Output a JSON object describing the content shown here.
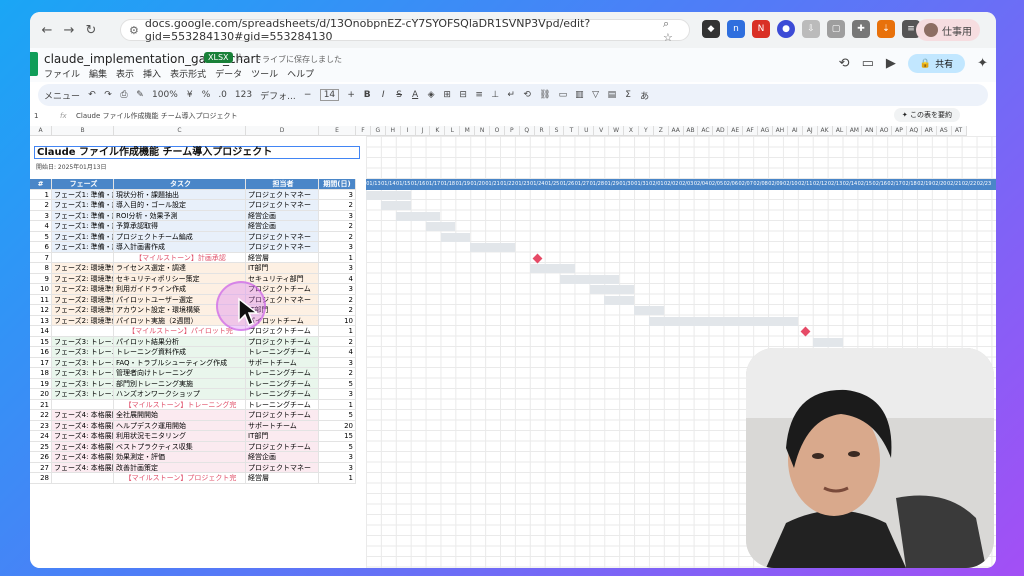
{
  "browser": {
    "url": "docs.google.com/spreadsheets/d/13OnobpnEZ-cY7SYOFSQlaDR1SVNP3Vpd/edit?gid=553284130#gid=553284130",
    "profile": "仕事用"
  },
  "doc": {
    "title": "claude_implementation_gantt_chart",
    "badge": "XLSX",
    "saved": "ドライブに保存しました",
    "menus": [
      "ファイル",
      "編集",
      "表示",
      "挿入",
      "表示形式",
      "データ",
      "ツール",
      "ヘルプ"
    ],
    "share": "共有"
  },
  "toolbar": {
    "menu": "メニュー",
    "zoom": "100%",
    "currency": "¥",
    "percent": "%",
    "fmt": "123",
    "font": "デフォ...",
    "size": "14",
    "bold": "B",
    "ime": "あ"
  },
  "formula": {
    "ref": "1",
    "content": "Claude ファイル作成機能 チーム導入プロジェクト",
    "explain": "この表を要約"
  },
  "columns": [
    "A",
    "B",
    "C",
    "D",
    "E",
    "F",
    "G",
    "H",
    "I",
    "J",
    "K",
    "L",
    "M",
    "N",
    "O",
    "P",
    "Q",
    "R",
    "S",
    "T",
    "U",
    "V",
    "W",
    "X",
    "Y",
    "Z",
    "AA",
    "AB",
    "AC",
    "AD",
    "AE",
    "AF",
    "AG",
    "AH",
    "AI",
    "AJ",
    "AK",
    "AL",
    "AM",
    "AN",
    "AO",
    "AP",
    "AQ",
    "AR",
    "AS",
    "AT"
  ],
  "project": {
    "title": "Claude ファイル作成機能 チーム導入プロジェクト",
    "start": "開始日: 2025年01月13日"
  },
  "headers": {
    "no": "#",
    "phase": "フェーズ",
    "task": "タスク",
    "owner": "担当者",
    "days": "期間(日)"
  },
  "dates": [
    "01/13",
    "01/14",
    "01/15",
    "01/16",
    "01/17",
    "01/18",
    "01/19",
    "01/20",
    "01/21",
    "01/22",
    "01/23",
    "01/24",
    "01/25",
    "01/26",
    "01/27",
    "01/28",
    "01/29",
    "01/30",
    "01/31",
    "02/01",
    "02/02",
    "02/03",
    "02/04",
    "02/05",
    "02/06",
    "02/07",
    "02/08",
    "02/09",
    "02/10",
    "02/11",
    "02/12",
    "02/13",
    "02/14",
    "02/15",
    "02/16",
    "02/17",
    "02/18",
    "02/19",
    "02/20",
    "02/21",
    "02/22",
    "02/23"
  ],
  "rows": [
    {
      "n": "1",
      "phase": "フェーズ1: 準備・計",
      "task": "現状分析・課題抽出",
      "owner": "プロジェクトマネー",
      "days": "3",
      "cls": "phase1",
      "start": 0,
      "len": 3
    },
    {
      "n": "2",
      "phase": "フェーズ1: 準備・計",
      "task": "導入目的・ゴール設定",
      "owner": "プロジェクトマネー",
      "days": "2",
      "cls": "phase1",
      "start": 1,
      "len": 2
    },
    {
      "n": "3",
      "phase": "フェーズ1: 準備・計",
      "task": "ROI分析・効果予測",
      "owner": "経営企画",
      "days": "3",
      "cls": "phase1",
      "start": 2,
      "len": 3
    },
    {
      "n": "4",
      "phase": "フェーズ1: 準備・計",
      "task": "予算承認取得",
      "owner": "経営企画",
      "days": "2",
      "cls": "phase1",
      "start": 4,
      "len": 2
    },
    {
      "n": "5",
      "phase": "フェーズ1: 準備・計",
      "task": "プロジェクトチーム編成",
      "owner": "プロジェクトマネー",
      "days": "2",
      "cls": "phase1",
      "start": 5,
      "len": 2
    },
    {
      "n": "6",
      "phase": "フェーズ1: 準備・計",
      "task": "導入計画書作成",
      "owner": "プロジェクトマネー",
      "days": "3",
      "cls": "phase1",
      "start": 7,
      "len": 3
    },
    {
      "n": "7",
      "phase": "",
      "task": "【マイルストーン】計画承認",
      "owner": "経営層",
      "days": "1",
      "cls": "milestone",
      "start": 11,
      "len": 0
    },
    {
      "n": "8",
      "phase": "フェーズ2: 環境準備",
      "task": "ライセンス選定・調達",
      "owner": "IT部門",
      "days": "3",
      "cls": "phase2",
      "start": 11,
      "len": 3
    },
    {
      "n": "9",
      "phase": "フェーズ2: 環境準備",
      "task": "セキュリティポリシー策定",
      "owner": "セキュリティ部門",
      "days": "4",
      "cls": "phase2",
      "start": 13,
      "len": 4
    },
    {
      "n": "10",
      "phase": "フェーズ2: 環境準備",
      "task": "利用ガイドライン作成",
      "owner": "プロジェクトチーム",
      "days": "3",
      "cls": "phase2",
      "start": 15,
      "len": 3
    },
    {
      "n": "11",
      "phase": "フェーズ2: 環境準備",
      "task": "パイロットユーザー選定",
      "owner": "プロジェクトマネー",
      "days": "2",
      "cls": "phase2",
      "start": 16,
      "len": 2
    },
    {
      "n": "12",
      "phase": "フェーズ2: 環境準備",
      "task": "アカウント設定・環境構築",
      "owner": "IT部門",
      "days": "2",
      "cls": "phase2",
      "start": 18,
      "len": 2
    },
    {
      "n": "13",
      "phase": "フェーズ2: 環境準備",
      "task": "パイロット実施（2週間）",
      "owner": "パイロットチーム",
      "days": "10",
      "cls": "phase2",
      "start": 19,
      "len": 10
    },
    {
      "n": "14",
      "phase": "",
      "task": "【マイルストーン】パイロット完",
      "owner": "プロジェクトチーム",
      "days": "1",
      "cls": "milestone",
      "start": 29,
      "len": 0
    },
    {
      "n": "15",
      "phase": "フェーズ3: トレーニ",
      "task": "パイロット結果分析",
      "owner": "プロジェクトチーム",
      "days": "2",
      "cls": "phase3",
      "start": 30,
      "len": 2
    },
    {
      "n": "16",
      "phase": "フェーズ3: トレーニ",
      "task": "トレーニング資料作成",
      "owner": "トレーニングチーム",
      "days": "4",
      "cls": "phase3",
      "start": 31,
      "len": 4
    },
    {
      "n": "17",
      "phase": "フェーズ3: トレーニ",
      "task": "FAQ・トラブルシューティング作成",
      "owner": "サポートチーム",
      "days": "3",
      "cls": "phase3",
      "start": 32,
      "len": 3
    },
    {
      "n": "18",
      "phase": "フェーズ3: トレーニ",
      "task": "管理者向けトレーニング",
      "owner": "トレーニングチーム",
      "days": "2",
      "cls": "phase3",
      "start": 34,
      "len": 2
    },
    {
      "n": "19",
      "phase": "フェーズ3: トレーニ",
      "task": "部門別トレーニング実施",
      "owner": "トレーニングチーム",
      "days": "5",
      "cls": "phase3",
      "start": 35,
      "len": 5
    },
    {
      "n": "20",
      "phase": "フェーズ3: トレーニ",
      "task": "ハンズオンワークショップ",
      "owner": "トレーニングチーム",
      "days": "3",
      "cls": "phase3",
      "start": 37,
      "len": 3
    },
    {
      "n": "21",
      "phase": "",
      "task": "【マイルストーン】トレーニング完",
      "owner": "トレーニングチーム",
      "days": "1",
      "cls": "milestone",
      "start": -1,
      "len": 0
    },
    {
      "n": "22",
      "phase": "フェーズ4: 本格展開",
      "task": "全社展開開始",
      "owner": "プロジェクトチーム",
      "days": "5",
      "cls": "phase4",
      "start": -1,
      "len": 0
    },
    {
      "n": "23",
      "phase": "フェーズ4: 本格展開",
      "task": "ヘルプデスク運用開始",
      "owner": "サポートチーム",
      "days": "20",
      "cls": "phase4",
      "start": -1,
      "len": 0
    },
    {
      "n": "24",
      "phase": "フェーズ4: 本格展開",
      "task": "利用状況モニタリング",
      "owner": "IT部門",
      "days": "15",
      "cls": "phase4",
      "start": -1,
      "len": 0
    },
    {
      "n": "25",
      "phase": "フェーズ4: 本格展開",
      "task": "ベストプラクティス収集",
      "owner": "プロジェクトチーム",
      "days": "5",
      "cls": "phase4",
      "start": -1,
      "len": 0
    },
    {
      "n": "26",
      "phase": "フェーズ4: 本格展開",
      "task": "効果測定・評価",
      "owner": "経営企画",
      "days": "3",
      "cls": "phase4",
      "start": -1,
      "len": 0
    },
    {
      "n": "27",
      "phase": "フェーズ4: 本格展開",
      "task": "改善計画策定",
      "owner": "プロジェクトマネー",
      "days": "3",
      "cls": "phase4",
      "start": -1,
      "len": 0
    },
    {
      "n": "28",
      "phase": "",
      "task": "【マイルストーン】プロジェクト完",
      "owner": "経営層",
      "days": "1",
      "cls": "milestone",
      "start": -1,
      "len": 0
    }
  ]
}
